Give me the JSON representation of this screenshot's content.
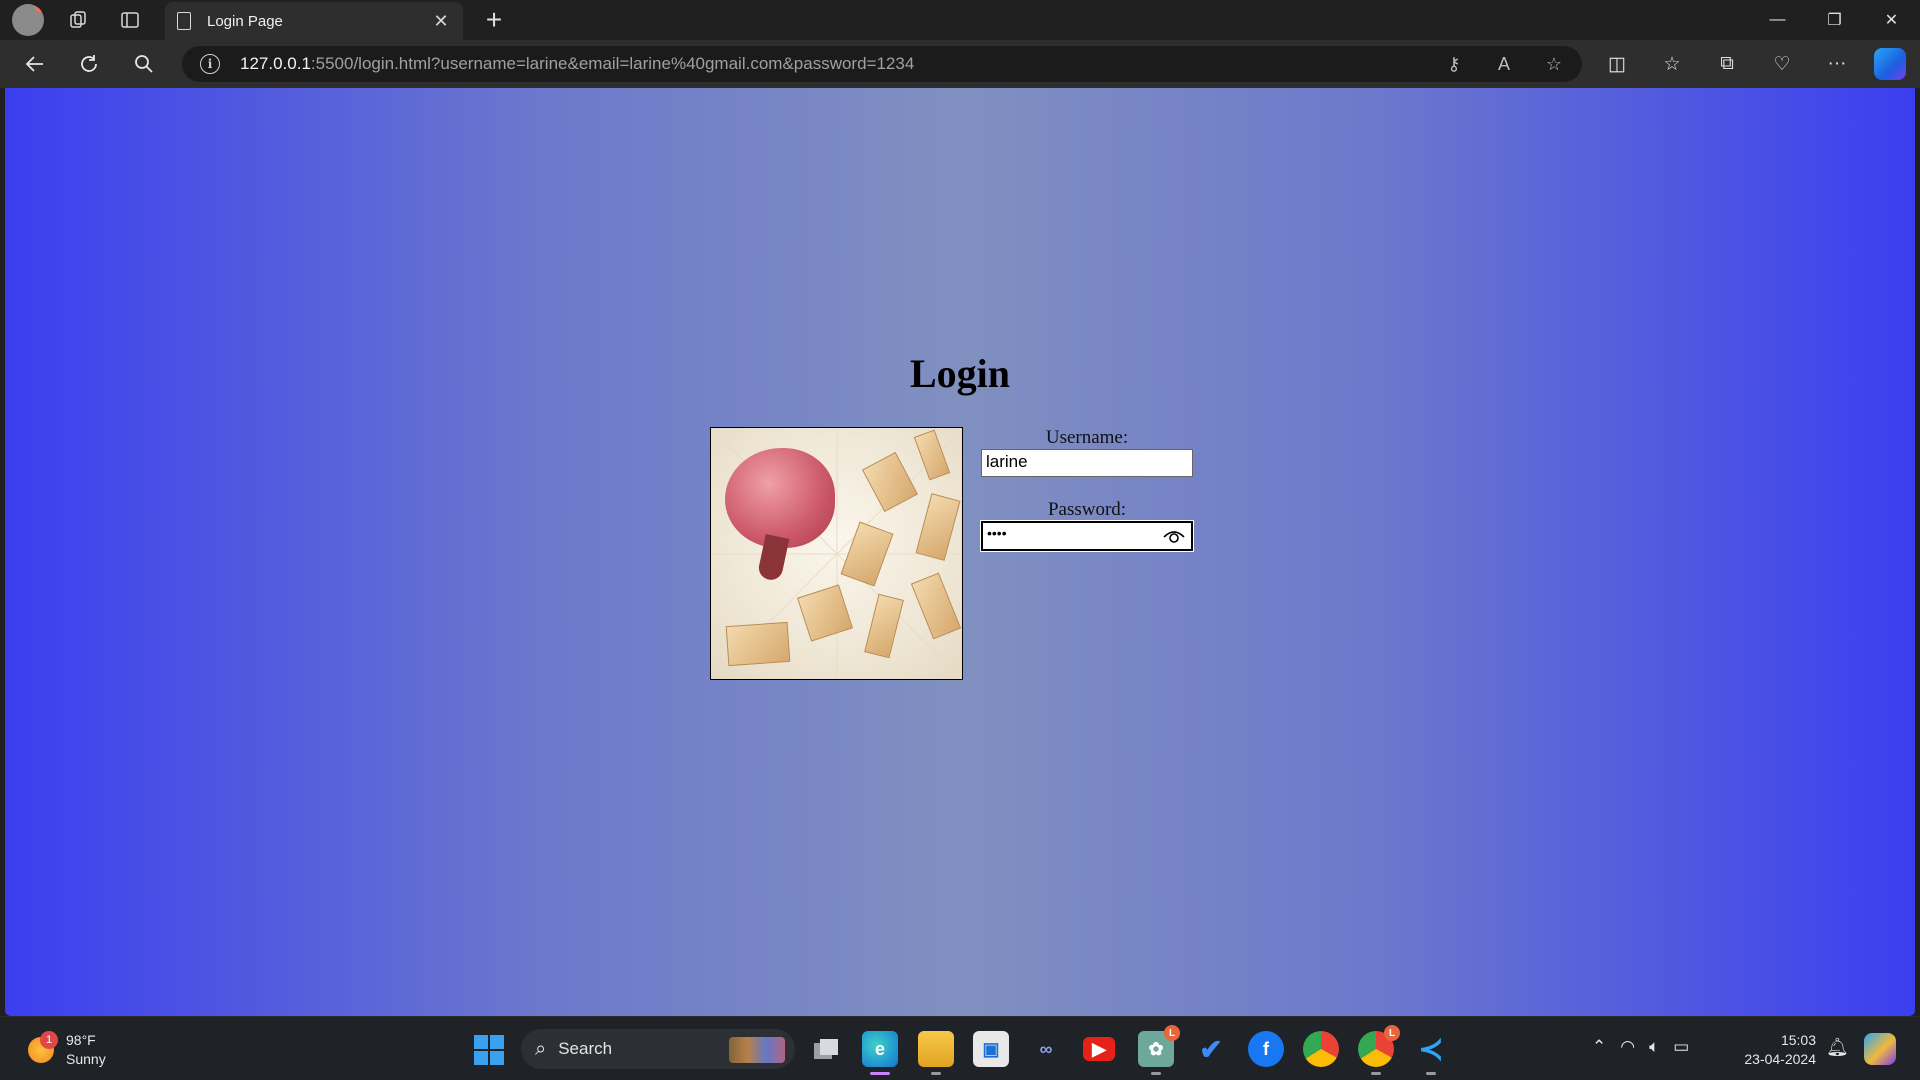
{
  "browser": {
    "tab_title": "Login Page",
    "url_host": "127.0.0.1",
    "url_rest": ":5500/login.html?username=larine&email=larine%40gmail.com&password=1234"
  },
  "page": {
    "heading": "Login",
    "username_label": "Username:",
    "username_value": "larine",
    "password_label": "Password:",
    "password_value": "••••"
  },
  "taskbar": {
    "weather_temp": "98°F",
    "weather_desc": "Sunny",
    "weather_badge": "1",
    "search_label": "Search",
    "time": "15:03",
    "date": "23-04-2024",
    "notif_badge": "L"
  },
  "colors": {
    "viewport_edge": "#3a3ef0",
    "viewport_center": "#8090c0",
    "accent": "#2ba5f5"
  }
}
